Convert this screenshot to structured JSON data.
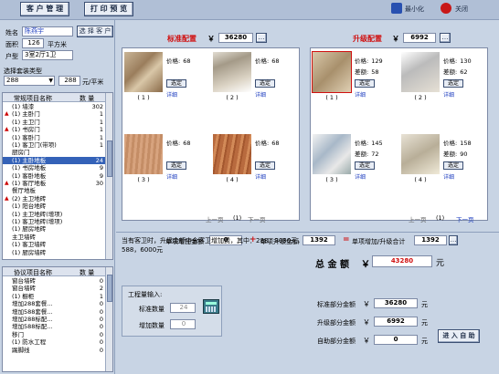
{
  "toolbar": {
    "customer_mgmt": "客 户 管 理",
    "print_preview": "打 印 预 览",
    "minimize": "最小化",
    "close": "关闭"
  },
  "customer": {
    "name_label": "姓名",
    "name_value": "陈燕宇",
    "area_label": "面积",
    "area_value": "126",
    "area_unit": "平方米",
    "layout_label": "户型",
    "layout_value": "3室2厅1卫",
    "choose_btn": "选 择 客 户",
    "package_label": "选择套装类型",
    "package_value": "288",
    "package_price": "288",
    "package_unit": "元/平米"
  },
  "regular_list": {
    "col_name": "常规项目名称",
    "col_qty": "数 量",
    "rows": [
      {
        "mark": "",
        "name": "(1) 墙漆",
        "qty": "302"
      },
      {
        "mark": "▲",
        "name": "(1) 主卧门",
        "qty": "1"
      },
      {
        "mark": "",
        "name": "(1) 主卫门",
        "qty": "1"
      },
      {
        "mark": "▲",
        "name": "(1) 书房门",
        "qty": "1"
      },
      {
        "mark": "",
        "name": "(1) 客卧门",
        "qty": "1"
      },
      {
        "mark": "",
        "name": "(1) 客卫门(带项)",
        "qty": "1"
      },
      {
        "mark": "",
        "name": "厨房门",
        "qty": ""
      },
      {
        "mark": "",
        "name": "(1) 主卧地板",
        "qty": "24"
      },
      {
        "mark": "",
        "name": "(1) 书房地板",
        "qty": "9"
      },
      {
        "mark": "",
        "name": "(1) 客卧地板",
        "qty": "9"
      },
      {
        "mark": "▲",
        "name": "(1) 客厅地板",
        "qty": "30"
      },
      {
        "mark": "",
        "name": "餐厅地板",
        "qty": ""
      },
      {
        "mark": "▲",
        "name": "(2) 主卫地砖",
        "qty": ""
      },
      {
        "mark": "",
        "name": "(1) 阳台地砖",
        "qty": ""
      },
      {
        "mark": "",
        "name": "(1) 主卫地砖(增项)",
        "qty": ""
      },
      {
        "mark": "",
        "name": "(1) 客卫地砖(增项)",
        "qty": ""
      },
      {
        "mark": "",
        "name": "(1) 厨房地砖",
        "qty": ""
      },
      {
        "mark": "",
        "name": "主卫墙砖",
        "qty": ""
      },
      {
        "mark": "",
        "name": "(1) 客卫墙砖",
        "qty": ""
      },
      {
        "mark": "",
        "name": "(1) 厨房墙砖",
        "qty": ""
      }
    ]
  },
  "protocol_list": {
    "col_name": "协议项目名称",
    "col_qty": "数 量",
    "rows": [
      {
        "name": "窗台墙砖",
        "qty": "0"
      },
      {
        "name": "窗台墙砖",
        "qty": "2"
      },
      {
        "name": "(1) 橱柜",
        "qty": "1"
      },
      {
        "name": "增加288套餐...",
        "qty": "0"
      },
      {
        "name": "增加588套餐...",
        "qty": "0"
      },
      {
        "name": "增加288标配...",
        "qty": "0"
      },
      {
        "name": "增加588标配...",
        "qty": "0"
      },
      {
        "name": "移门",
        "qty": "0"
      },
      {
        "name": "(1) 防水工程",
        "qty": "0"
      },
      {
        "name": "踢脚线",
        "qty": "0"
      }
    ]
  },
  "standard": {
    "title": "标准配置",
    "yen": "￥",
    "total": "36280",
    "items": [
      {
        "caption": "( 1 )",
        "price_label": "价格:",
        "price": "68",
        "select": "选定",
        "detail": "详细"
      },
      {
        "caption": "( 2 )",
        "price_label": "价格:",
        "price": "68",
        "select": "选定",
        "detail": "详细"
      },
      {
        "caption": "( 3 )",
        "price_label": "价格:",
        "price": "68",
        "select": "选定",
        "detail": "详细"
      },
      {
        "caption": "( 4 )",
        "price_label": "价格:",
        "price": "68",
        "select": "选定",
        "detail": "详细"
      }
    ],
    "pager": {
      "prev": "上一页",
      "page": "(1)",
      "next": "下一页"
    }
  },
  "upgrade": {
    "title": "升级配置",
    "yen": "￥",
    "total": "6992",
    "items": [
      {
        "caption": "( 1 )",
        "price_label": "价格:",
        "price": "129",
        "diff_label": "差额:",
        "diff": "58",
        "select": "选定",
        "detail": "详细"
      },
      {
        "caption": "( 2 )",
        "price_label": "价格:",
        "price": "130",
        "diff_label": "差额:",
        "diff": "62",
        "select": "选定",
        "detail": "详细"
      },
      {
        "caption": "( 3 )",
        "price_label": "价格:",
        "price": "145",
        "diff_label": "差额:",
        "diff": "72",
        "select": "选定",
        "detail": "详细"
      },
      {
        "caption": "( 4 )",
        "price_label": "价格:",
        "price": "158",
        "diff_label": "差额:",
        "diff": "90",
        "select": "选定",
        "detail": "详细"
      }
    ],
    "pager": {
      "prev": "上一页",
      "page": "(1)",
      "next": "下一页"
    }
  },
  "single": {
    "add_label": "单项增加金额",
    "add_value": "0",
    "plus": "+",
    "upgrade_label": "单项升级金额",
    "upgrade_value": "1392",
    "equals": "=",
    "total_label": "单项增加/升级合计",
    "total_value": "1392"
  },
  "note": "当有客卫时，升级金额中含客卫增加费，其中：288，3080元，588，6000元",
  "work": {
    "title": "工程量输入:",
    "std_label": "标准数量",
    "std_value": "24",
    "add_label": "增加数量",
    "add_value": "0"
  },
  "totals": {
    "grand_label": "总 金 额",
    "yen": "￥",
    "grand_value": "43280",
    "unit": "元",
    "std_label": "标准部分金额",
    "std_value": "36280",
    "up_label": "升级部分金额",
    "up_value": "6992",
    "self_label": "自助部分金额",
    "self_value": "0",
    "autohelp_btn": "进 入 自 助"
  },
  "colors": {
    "accent_red": "#d01010",
    "selected_row": "#3462b8",
    "link_blue": "#2040c0"
  }
}
